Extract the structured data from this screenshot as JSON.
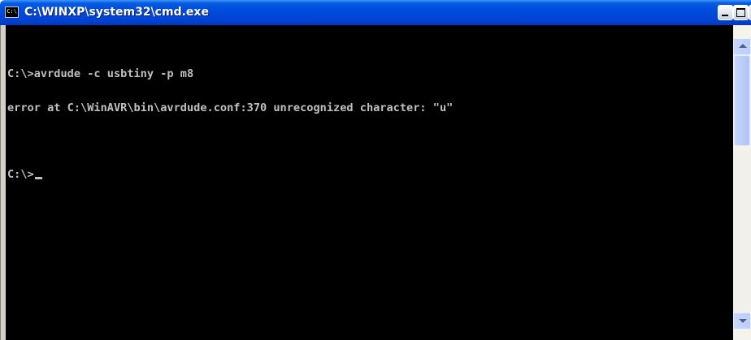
{
  "window": {
    "title": "C:\\WINXP\\system32\\cmd.exe",
    "icon": "cmd-window-icon",
    "icon_text": "C:\\"
  },
  "title_buttons": {
    "minimize_icon": "minimize-icon",
    "maximize_icon": "maximize-icon",
    "close_icon": "close-icon",
    "close_glyph": "×"
  },
  "console": {
    "lines": [
      "C:\\>avrdude -c usbtiny -p m8",
      "error at C:\\WinAVR\\bin\\avrdude.conf:370 unrecognized character: \"u\""
    ],
    "prompt": "C:\\>",
    "background_color": "#000000",
    "text_color": "#c0c0c0"
  },
  "scrollbar": {
    "up_icon": "scroll-up-arrow-icon",
    "down_icon": "scroll-down-arrow-icon"
  },
  "colors": {
    "titlebar": "#0050e0",
    "title_text": "#ffffff",
    "scroll_accent": "#bccdf8"
  }
}
